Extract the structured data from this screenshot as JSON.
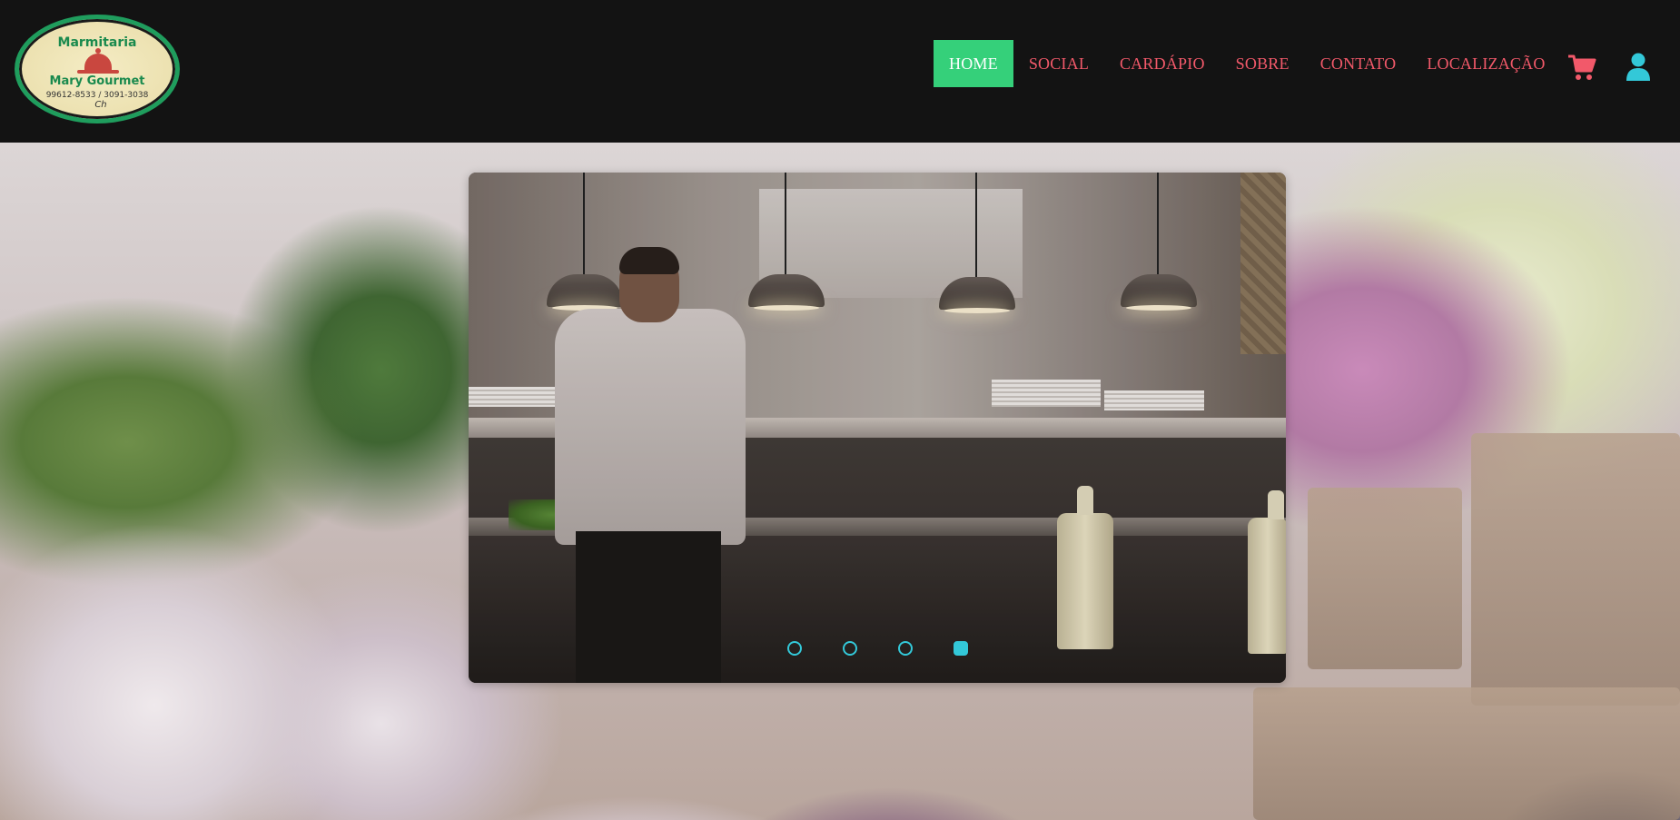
{
  "brand": {
    "logo_line1": "Marmitaria",
    "logo_line2": "Mary Gourmet",
    "logo_phones": "99612-8533 / 3091-3038",
    "logo_signature": "Ch"
  },
  "nav": {
    "items": [
      {
        "label": "HOME",
        "active": true
      },
      {
        "label": "SOCIAL",
        "active": false
      },
      {
        "label": "CARDÁPIO",
        "active": false
      },
      {
        "label": "SOBRE",
        "active": false
      },
      {
        "label": "CONTATO",
        "active": false
      },
      {
        "label": "LOCALIZAÇÃO",
        "active": false
      }
    ],
    "cart_icon": "shopping-cart-icon",
    "user_icon": "user-icon"
  },
  "carousel": {
    "slide_count": 4,
    "active_slide": 4,
    "current_image": "restaurant-kitchen-chef-photo"
  },
  "colors": {
    "header_bg": "#131313",
    "nav_text": "#f2596a",
    "nav_active_bg": "#35d07a",
    "user_icon": "#33c8d8",
    "dot": "#33c8d8",
    "logo_green": "#1f9d5d"
  }
}
